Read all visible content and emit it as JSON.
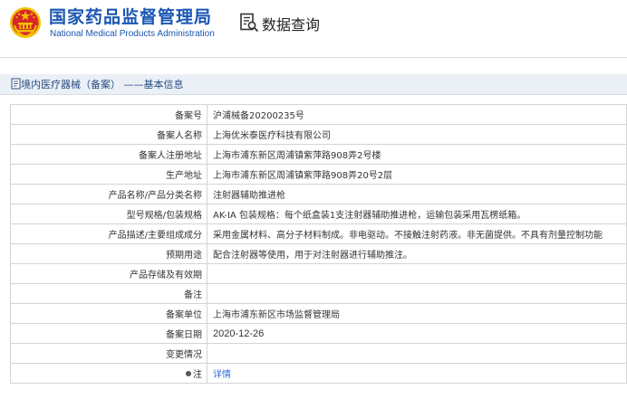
{
  "header": {
    "brand_cn": "国家药品监督管理局",
    "brand_en": "National Medical Products Administration",
    "query_title": "数据查询"
  },
  "breadcrumb": {
    "text": "境内医疗器械（备案） ——基本信息"
  },
  "record": {
    "rows": [
      {
        "label": "备案号",
        "value": "沪浦械备20200235号"
      },
      {
        "label": "备案人名称",
        "value": "上海优米泰医疗科技有限公司"
      },
      {
        "label": "备案人注册地址",
        "value": "上海市浦东新区周浦镇紫萍路908弄2号楼"
      },
      {
        "label": "生产地址",
        "value": "上海市浦东新区周浦镇紫萍路908弄20号2层"
      },
      {
        "label": "产品名称/产品分类名称",
        "value": "注射器辅助推进枪"
      },
      {
        "label": "型号规格/包装规格",
        "value": "AK-ⅠA 包装规格：每个纸盒装1支注射器辅助推进枪，运输包装采用瓦楞纸箱。"
      },
      {
        "label": "产品描述/主要组成成分",
        "value": "采用金属材料、高分子材料制成。非电驱动。不接触注射药液。非无菌提供。不具有剂量控制功能"
      },
      {
        "label": "预期用途",
        "value": "配合注射器等使用，用于对注射器进行辅助推注。"
      },
      {
        "label": "产品存储及有效期",
        "value": ""
      },
      {
        "label": "备注",
        "value": ""
      },
      {
        "label": "备案单位",
        "value": "上海市浦东新区市场监督管理局"
      },
      {
        "label": "备案日期",
        "value": "2020-12-26"
      },
      {
        "label": "变更情况",
        "value": ""
      }
    ],
    "note_label": "注",
    "note_link": "详情"
  },
  "colors": {
    "brand_blue": "#1a56b2",
    "emblem_red": "#d8272c",
    "emblem_gold": "#f2c200",
    "link_blue": "#2f6bd8",
    "breadcrumb_bg": "#eaf0f6"
  }
}
